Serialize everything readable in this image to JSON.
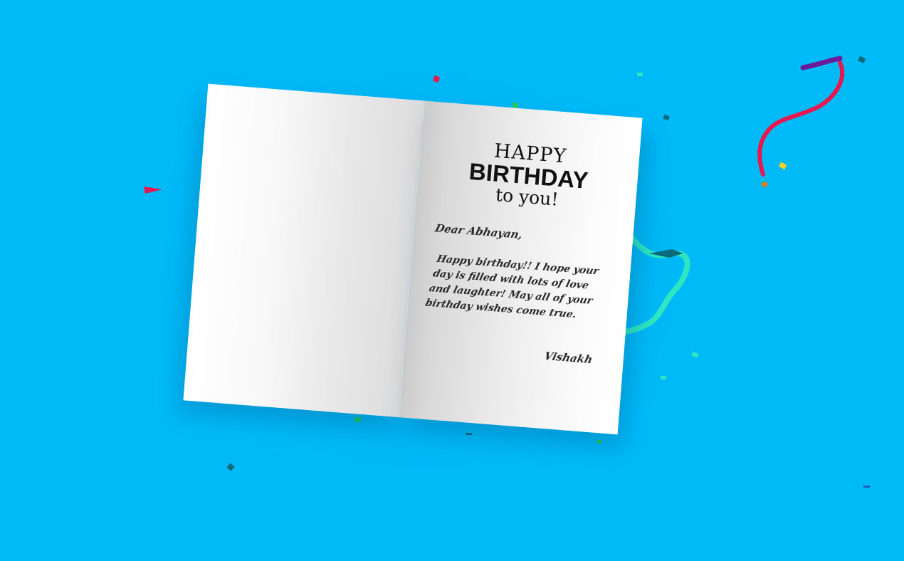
{
  "card": {
    "title_line1": "HAPPY",
    "title_line2": "BIRTHDAY",
    "title_line3": "to you!",
    "greeting": "Dear Abhayan,",
    "message": "Happy birthday!! I hope your day is filled with lots of love and laughter! May all of your birthday wishes come true.",
    "signature": "Vishakh"
  },
  "colors": {
    "background": "#00baf8",
    "ribbon_red": "#e8174f",
    "ribbon_purple": "#6a1b9a",
    "ribbon_teal": "#2ee6c0",
    "confetti_green": "#1ec96b",
    "confetti_dark_teal": "#0d6b7a",
    "confetti_yellow": "#ffd21f"
  }
}
